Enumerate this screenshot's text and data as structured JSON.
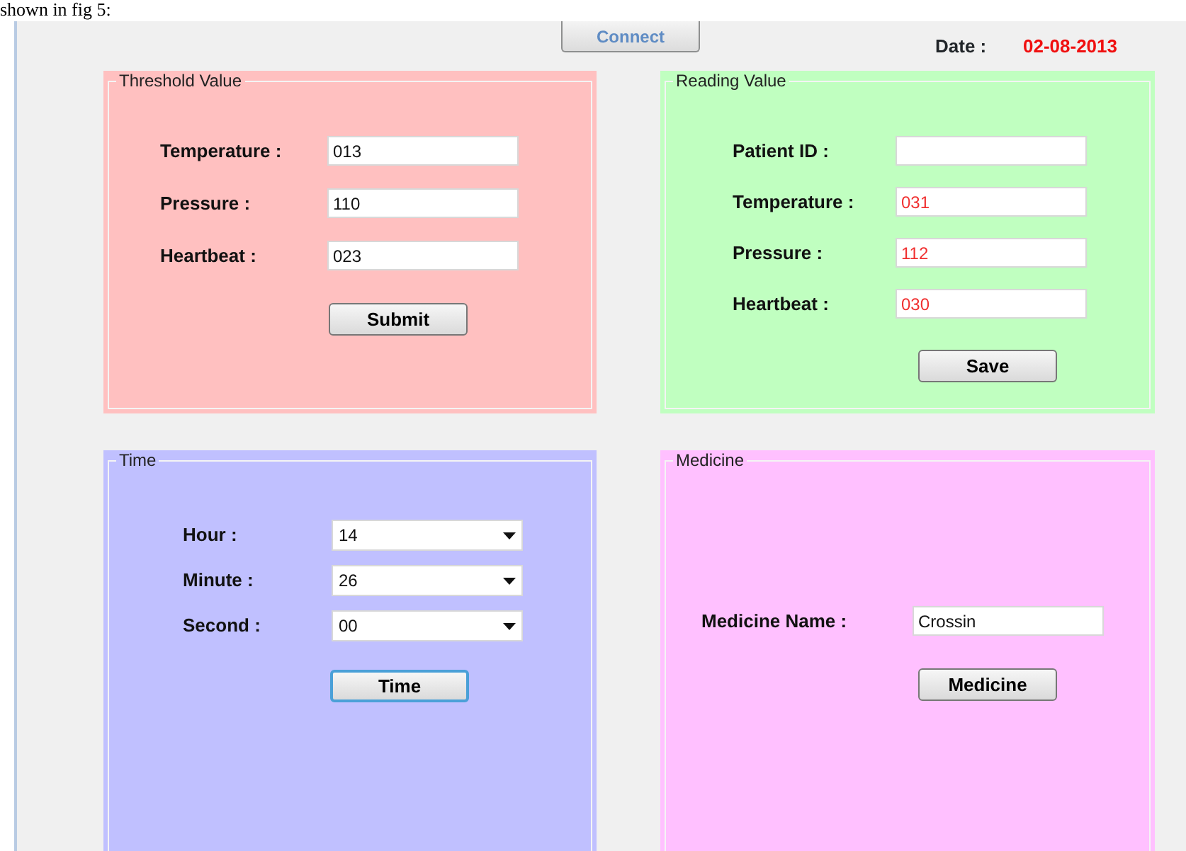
{
  "caption": "shown in fig 5:",
  "connect_button": {
    "label": "Connect",
    "disabled": true
  },
  "date": {
    "label": "Date :",
    "value": "02-08-2013"
  },
  "groups": [
    {
      "title": "Threshold Value",
      "color": "#ffc0c0",
      "fields": [
        {
          "kind": "text",
          "label": "Temperature :",
          "value": "013",
          "highlighted": false
        },
        {
          "kind": "text",
          "label": "Pressure :",
          "value": "110",
          "highlighted": false
        },
        {
          "kind": "text",
          "label": "Heartbeat :",
          "value": "023",
          "highlighted": false
        }
      ],
      "button": {
        "label": "Submit",
        "focused": false
      }
    },
    {
      "title": "Reading Value",
      "color": "#c0ffc0",
      "fields": [
        {
          "kind": "text",
          "label": "Patient ID :"
        },
        {
          "kind": "text",
          "label": "Temperature :",
          "value": "031",
          "highlighted": true
        },
        {
          "kind": "text",
          "label": "Pressure :",
          "value": "112",
          "highlighted": true
        },
        {
          "kind": "text",
          "label": "Heartbeat :",
          "value": "030",
          "highlighted": true
        }
      ],
      "button": {
        "label": "Save",
        "focused": false
      }
    },
    {
      "title": "Time",
      "color": "#c0c0ff",
      "fields": [
        {
          "kind": "combo",
          "label": "Hour :",
          "value": "14",
          "highlighted": false
        },
        {
          "kind": "combo",
          "label": "Minute :",
          "value": "26",
          "highlighted": false
        },
        {
          "kind": "combo",
          "label": "Second :",
          "value": "00",
          "highlighted": false
        }
      ],
      "button": {
        "label": "Time",
        "focused": true
      }
    },
    {
      "title": "Medicine",
      "color": "#ffc0ff",
      "fields": [
        {
          "kind": "text",
          "label": "Medicine Name :",
          "value": "Crossin",
          "highlighted": false
        }
      ],
      "button": {
        "label": "Medicine",
        "focused": false
      }
    }
  ]
}
